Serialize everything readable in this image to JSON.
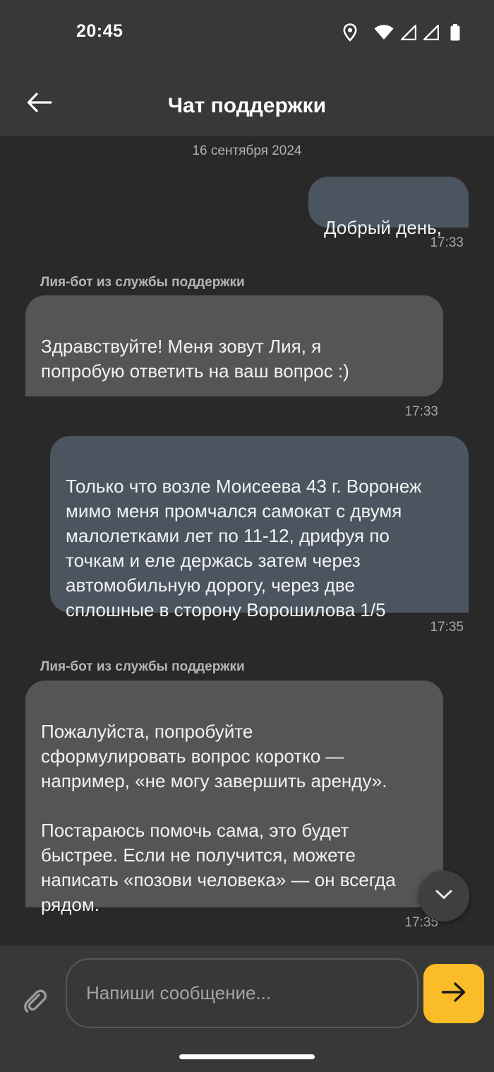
{
  "status_bar": {
    "time": "20:45",
    "icons": [
      "location-icon",
      "wifi-icon",
      "signal-icon",
      "signal-icon",
      "battery-icon"
    ]
  },
  "header": {
    "back_icon": "arrow-left-icon",
    "title": "Чат поддержки"
  },
  "chat": {
    "date": "16 сентября 2024",
    "messages": [
      {
        "direction": "outgoing",
        "text": "Добрый день,",
        "time": "17:33"
      },
      {
        "direction": "incoming",
        "sender": "Лия-бот из службы поддержки",
        "text": "Здравствуйте! Меня зовут Лия, я\nпопробую ответить на ваш вопрос :)",
        "time": "17:33"
      },
      {
        "direction": "outgoing",
        "text": "Только что возле Моисеева 43 г. Воронеж\nмимо меня промчался самокат с двумя\nмалолетками лет по 11-12, дрифуя по\nточкам и еле держась затем через\nавтомобильную дорогу, через две\nсплошные в сторону Ворошилова 1/5",
        "time": "17:35"
      },
      {
        "direction": "incoming",
        "sender": "Лия-бот из службы поддержки",
        "text": "Пожалуйста, попробуйте\nсформулировать вопрос коротко —\nнапример, «не могу завершить аренду».\n\nПостараюсь помочь сама, это будет\nбыстрее. Если не получится, можете\nнаписать «позови человека» — он всегда\nрядом.",
        "time": "17:35"
      }
    ],
    "scroll_down_icon": "chevron-down-icon"
  },
  "composer": {
    "attach_icon": "paperclip-icon",
    "input_value": "",
    "input_placeholder": "Напиши сообщение...",
    "send_icon": "arrow-right-icon"
  },
  "colors": {
    "background": "#292929",
    "bars": "#383838",
    "outgoing_bubble": "#4b5560",
    "incoming_bubble": "#555555",
    "send_button": "#fbbd27"
  }
}
